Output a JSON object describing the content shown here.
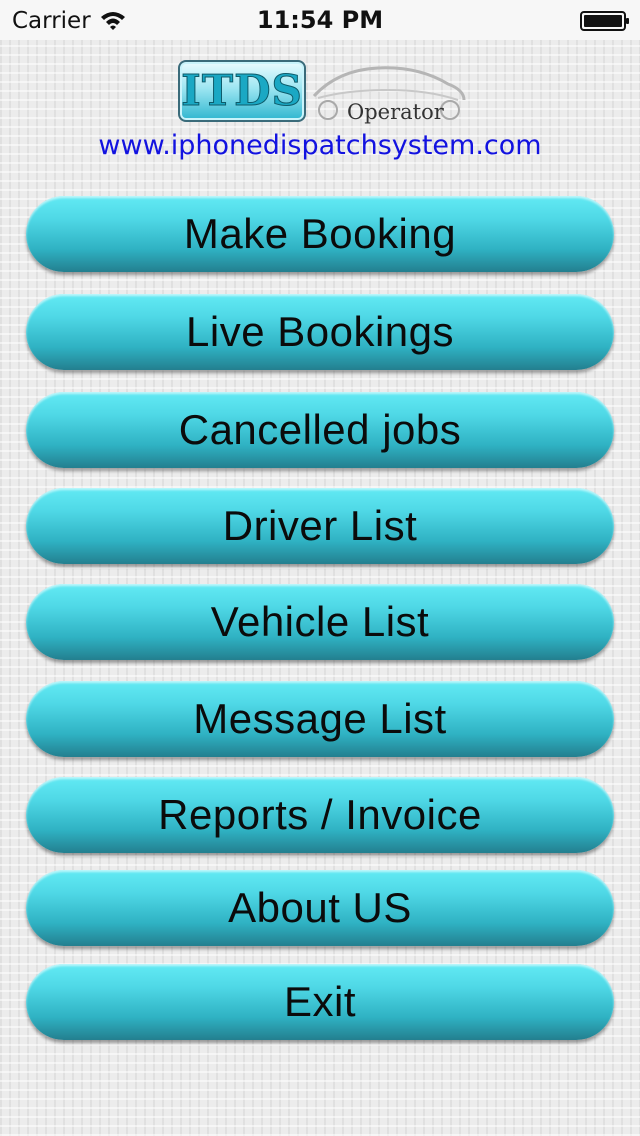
{
  "status_bar": {
    "carrier": "Carrier",
    "time": "11:54 PM"
  },
  "header": {
    "logo_text": "ITDS",
    "operator_label": "Operator",
    "website": "www.iphonedispatchsystem.com"
  },
  "menu": {
    "items": [
      {
        "label": "Make Booking"
      },
      {
        "label": "Live Bookings"
      },
      {
        "label": "Cancelled jobs"
      },
      {
        "label": "Driver List"
      },
      {
        "label": "Vehicle List"
      },
      {
        "label": "Message List"
      },
      {
        "label": "Reports / Invoice"
      },
      {
        "label": "About US"
      },
      {
        "label": "Exit"
      }
    ]
  },
  "colors": {
    "button_top": "#62eaf4",
    "button_bottom": "#237f8f",
    "link": "#1212e0"
  }
}
